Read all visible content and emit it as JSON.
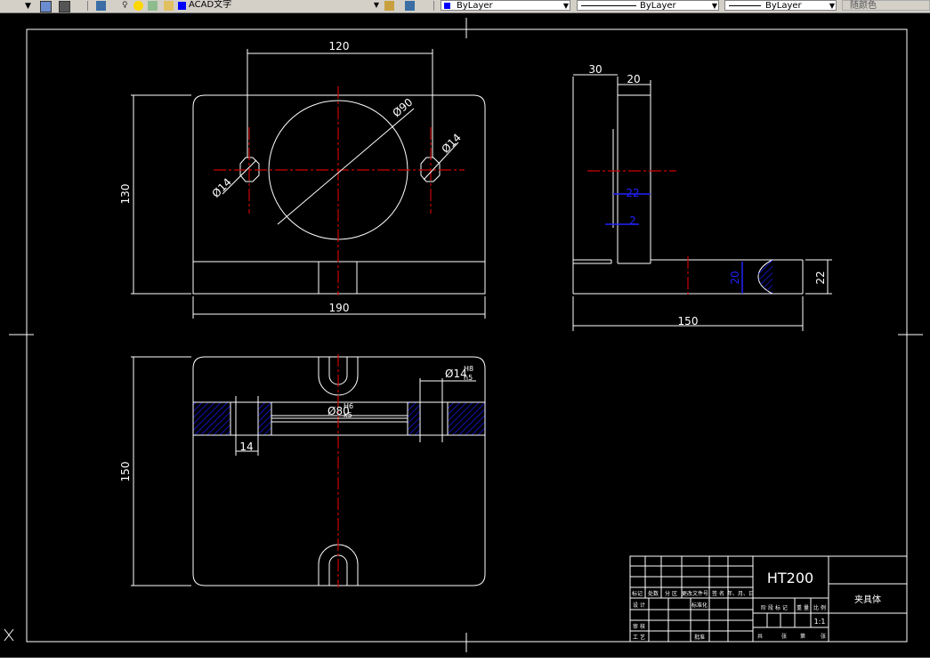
{
  "toolbar": {
    "text_style_value": "ACAD文字",
    "color_value": "ByLayer",
    "linetype_value": "ByLayer",
    "lineweight_value": "ByLayer",
    "plotstyle_value": "随颜色"
  },
  "colors": {
    "background": "#000000",
    "outline": "#ffffff",
    "centerline": "#cc0000",
    "hatch": "#1a1aff",
    "highlight_dim": "#2222ff"
  },
  "drawing": {
    "dims": {
      "top_width_hole_spacing": "120",
      "diameter_bore": "Ø90",
      "hole_left": "Ø14",
      "hole_right": "Ø14",
      "height_front": "130",
      "width_front": "190",
      "side_depth": "30",
      "side_thickness": "20",
      "side_rib": "22",
      "side_small": "2",
      "side_base_height": "22",
      "side_hatch_height": "20",
      "side_length": "150",
      "plan_height": "150",
      "plan_hole_fit": "Ø14",
      "plan_hole_fit_upper": "H8",
      "plan_hole_fit_lower": "h5",
      "plan_bore_fit": "Ø80",
      "plan_bore_fit_upper": "H6",
      "plan_bore_fit_lower": "k5",
      "plan_hole_width": "14"
    },
    "title_block": {
      "material": "HT200",
      "part_name": "夹具体",
      "scale": "1:1",
      "row_labels": [
        "设 计",
        "审 核",
        "工 艺"
      ],
      "header_cells": [
        "标记",
        "处数",
        "分 区",
        "更改文件号",
        "签 名",
        "年、月、日"
      ],
      "std_label": "标准化",
      "approve_label": "批准",
      "stage_headers": [
        "阶 段 标 记",
        "重 量",
        "比 例"
      ],
      "sheet_labels": [
        "共",
        "张",
        "第",
        "张"
      ]
    }
  }
}
